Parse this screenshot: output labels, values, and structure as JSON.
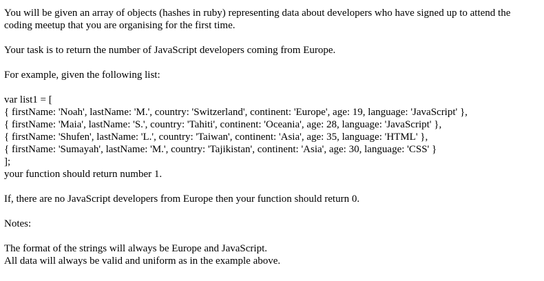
{
  "intro": "You will be given an array of objects (hashes in ruby) representing data about developers who have signed up to attend the coding meetup that you are organising for the first time.",
  "task": "Your task is to return the number of JavaScript developers coming from Europe.",
  "example_intro": "For example, given the following list:",
  "code_lines": [
    "var list1 = [",
    "{ firstName: 'Noah', lastName: 'M.', country: 'Switzerland', continent: 'Europe', age: 19, language: 'JavaScript' },",
    "{ firstName: 'Maia', lastName: 'S.', country: 'Tahiti', continent: 'Oceania', age: 28, language: 'JavaScript' },",
    "{ firstName: 'Shufen', lastName: 'L.', country: 'Taiwan', continent: 'Asia', age: 35, language: 'HTML' },",
    "{ firstName: 'Sumayah', lastName: 'M.', country: 'Tajikistan', continent: 'Asia', age: 30, language: 'CSS' }",
    "];"
  ],
  "result": "your function should return number 1.",
  "no_devs": "If, there are no JavaScript developers from Europe then your function should return 0.",
  "notes_heading": "Notes:",
  "notes": [
    "The format of the strings will always be Europe and JavaScript.",
    "All data will always be valid and uniform as in the example above."
  ]
}
